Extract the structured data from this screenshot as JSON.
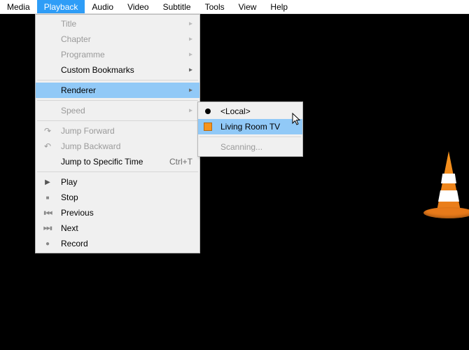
{
  "menubar": {
    "items": [
      "Media",
      "Playback",
      "Audio",
      "Video",
      "Subtitle",
      "Tools",
      "View",
      "Help"
    ],
    "active_index": 1
  },
  "playback_menu": {
    "items": [
      {
        "label": "Title",
        "disabled": true,
        "submenu": true
      },
      {
        "label": "Chapter",
        "disabled": true,
        "submenu": true
      },
      {
        "label": "Programme",
        "disabled": true,
        "submenu": true
      },
      {
        "label": "Custom Bookmarks",
        "submenu": true
      },
      {
        "separator": true
      },
      {
        "label": "Renderer",
        "submenu": true,
        "highlight": true
      },
      {
        "separator": true
      },
      {
        "label": "Speed",
        "disabled": true,
        "submenu": true
      },
      {
        "separator": true
      },
      {
        "label": "Jump Forward",
        "icon": "jump-forward-icon",
        "disabled": true
      },
      {
        "label": "Jump Backward",
        "icon": "jump-backward-icon",
        "disabled": true
      },
      {
        "label": "Jump to Specific Time",
        "shortcut": "Ctrl+T"
      },
      {
        "separator": true
      },
      {
        "label": "Play",
        "icon": "play-icon"
      },
      {
        "label": "Stop",
        "icon": "stop-icon"
      },
      {
        "label": "Previous",
        "icon": "previous-icon"
      },
      {
        "label": "Next",
        "icon": "next-icon"
      },
      {
        "label": "Record",
        "icon": "record-icon"
      }
    ]
  },
  "renderer_submenu": {
    "items": [
      {
        "label": "<Local>",
        "marker": "dot"
      },
      {
        "label": "Living Room TV",
        "marker": "square",
        "highlight": true
      },
      {
        "separator": true
      },
      {
        "label": "Scanning...",
        "disabled": true
      }
    ]
  },
  "icon_glyphs": {
    "jump-forward-icon": "↷",
    "jump-backward-icon": "↶",
    "play-icon": "▶",
    "stop-icon": "■",
    "previous-icon": "▮◀◀",
    "next-icon": "▶▶▮",
    "record-icon": "●",
    "submenu-arrow": "▸"
  }
}
